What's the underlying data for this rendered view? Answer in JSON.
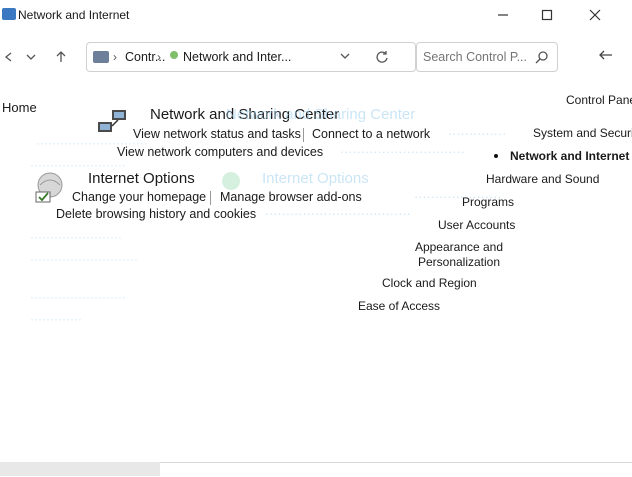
{
  "window": {
    "title": "Network and Internet"
  },
  "nav": {
    "back_icon": "arrow-left-icon",
    "forward_icon": "arrow-right-icon",
    "recent_icon": "chevron-down-icon",
    "up_icon": "arrow-up-icon"
  },
  "address": {
    "segments": [
      "Contr...",
      "Network and Inter..."
    ],
    "refresh_icon": "refresh-icon"
  },
  "search": {
    "placeholder": "Search Control P..."
  },
  "sidebar": {
    "home": "Home"
  },
  "sections": [
    {
      "title": "Network and Sharing Center",
      "icon": "network-icon",
      "tasks": [
        "View network status and tasks",
        "Connect to a network",
        "View network computers and devices"
      ]
    },
    {
      "title": "Internet Options",
      "icon": "internet-options-icon",
      "tasks": [
        "Change your homepage",
        "Manage browser add-ons",
        "Delete browsing history and cookies"
      ]
    }
  ],
  "category_menu": {
    "header": "Control Pane",
    "items": [
      {
        "label": "System and Securit",
        "active": false
      },
      {
        "label": "Network and Internet",
        "active": true
      },
      {
        "label": "Hardware and Sound",
        "active": false
      },
      {
        "label": "Programs",
        "active": false
      },
      {
        "label": "User Accounts",
        "active": false
      },
      {
        "label": "Appearance and Personalization",
        "active": false
      },
      {
        "label": "Clock and Region",
        "active": false
      },
      {
        "label": "Ease of Access",
        "active": false
      }
    ]
  },
  "colors": {
    "accent": "#0b6fbf",
    "ghost": "#9fd0ef"
  }
}
